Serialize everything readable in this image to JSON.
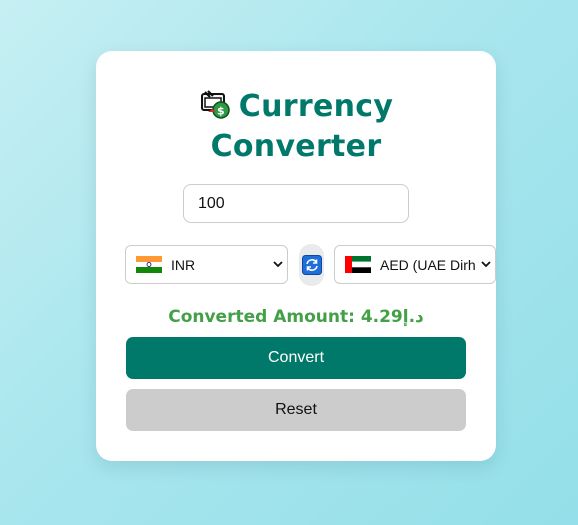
{
  "app": {
    "title_line1": "Currency",
    "title_line2": "Converter",
    "title_icon": "currency-exchange-icon"
  },
  "form": {
    "amount_value": "100",
    "from_currency": "INR",
    "from_flag": "india-flag-icon",
    "to_currency": "AED (UAE Dirh",
    "to_flag": "uae-flag-icon",
    "swap_icon": "swap-icon"
  },
  "result": {
    "text": "Converted Amount: 4.29د.إ"
  },
  "buttons": {
    "convert_label": "Convert",
    "reset_label": "Reset"
  },
  "colors": {
    "accent": "#00796b",
    "result": "#43a047",
    "reset_bg": "#cccccc"
  }
}
